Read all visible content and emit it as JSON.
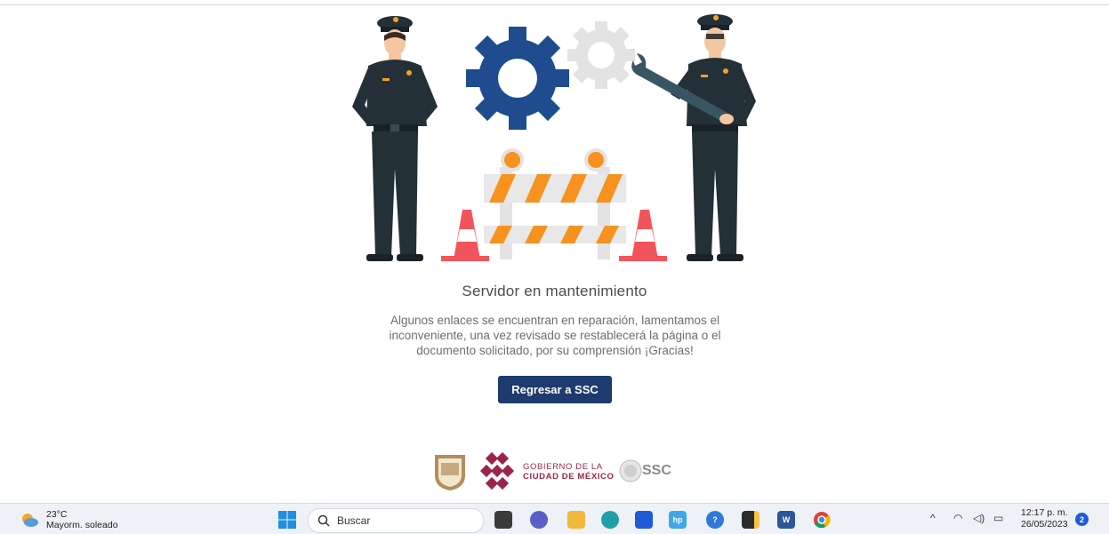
{
  "page": {
    "title": "Servidor en mantenimiento",
    "message": "Algunos enlaces se encuentran en reparación, lamentamos el inconveniente, una vez revisado se restablecerá la página o el documento solicitado, por su comprensión ¡Gracias!",
    "back_button_label": "Regresar a SSC"
  },
  "footer": {
    "gov_line1": "GOBIERNO DE LA",
    "gov_line2": "CIUDAD DE MÉXICO",
    "ssc_label": "SSC"
  },
  "taskbar": {
    "weather_temp": "23°C",
    "weather_desc": "Mayorm. soleado",
    "search_placeholder": "Buscar",
    "clock_time": "12:17 p. m.",
    "clock_date": "26/05/2023",
    "notification_count": "2",
    "pinned_apps": [
      "file-explorer-dark",
      "teams-chat",
      "file-explorer",
      "edge",
      "microsoft-store",
      "myhp",
      "help",
      "sticky-notes",
      "word",
      "chrome"
    ]
  },
  "colors": {
    "button_bg": "#1e3b6e",
    "gear_blue": "#1f4c8f",
    "gear_gray": "#e3e3e3",
    "uniform": "#243038",
    "barrier_orange": "#f7921e",
    "cone_red": "#f2545b",
    "gov_red": "#9d2449"
  }
}
